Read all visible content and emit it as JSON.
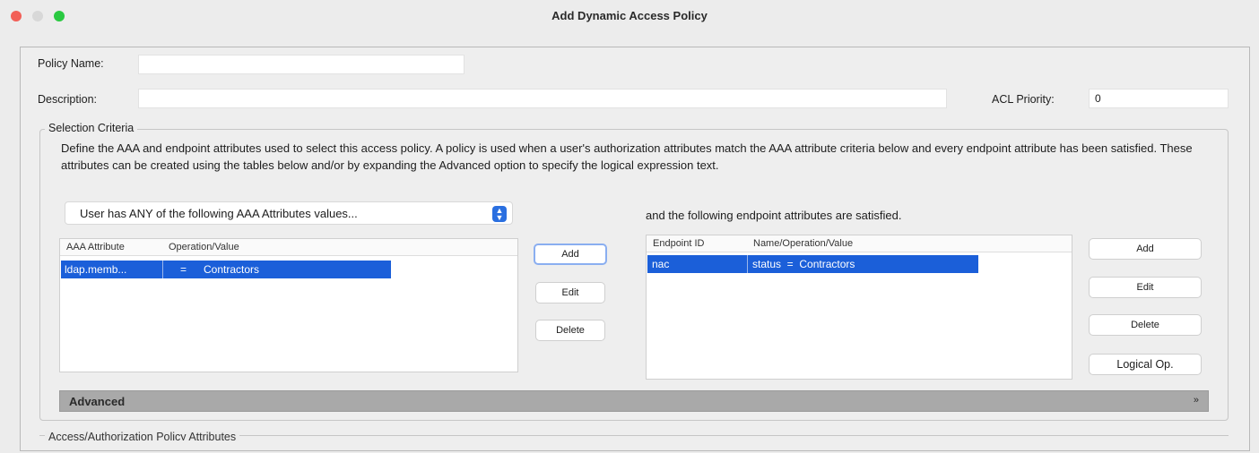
{
  "window": {
    "title": "Add Dynamic Access Policy"
  },
  "policy_name": {
    "label": "Policy Name:",
    "value": ""
  },
  "description": {
    "label": "Description:",
    "value": ""
  },
  "acl_priority": {
    "label": "ACL Priority:",
    "value": "0"
  },
  "selection_criteria": {
    "title": "Selection Criteria",
    "description": "Define the AAA and endpoint attributes used to select this access policy. A policy is used when a user's authorization attributes match the AAA attribute criteria below and every endpoint attribute has been satisfied. These attributes can be created using the tables below and/or by expanding the Advanced option to specify the logical expression text.",
    "aaa_match_select": {
      "value": "User has ANY of the following AAA Attributes values..."
    },
    "endpoint_heading": "and the following endpoint attributes are satisfied."
  },
  "aaa_table": {
    "columns": [
      "AAA Attribute",
      "Operation/Value"
    ],
    "rows": [
      {
        "attribute": "ldap.memb...",
        "operation": "=",
        "value": "Contractors"
      }
    ]
  },
  "aaa_buttons": {
    "add": "Add",
    "edit": "Edit",
    "delete": "Delete"
  },
  "endpoint_table": {
    "columns": [
      "Endpoint ID",
      "Name/Operation/Value"
    ],
    "rows": [
      {
        "id": "nac",
        "name_op_value": "status  =  Contractors"
      }
    ]
  },
  "endpoint_buttons": {
    "add": "Add",
    "edit": "Edit",
    "delete": "Delete",
    "logical_op": "Logical Op."
  },
  "advanced": {
    "label": "Advanced",
    "toggle_icon": "»"
  },
  "bottom_section": {
    "title": "Access/Authorization Policy Attributes"
  },
  "colors": {
    "selection": "#1b5fd9",
    "close": "#f25f57",
    "maximize": "#2ac941",
    "popup_arrow": "#2a6fe0"
  }
}
